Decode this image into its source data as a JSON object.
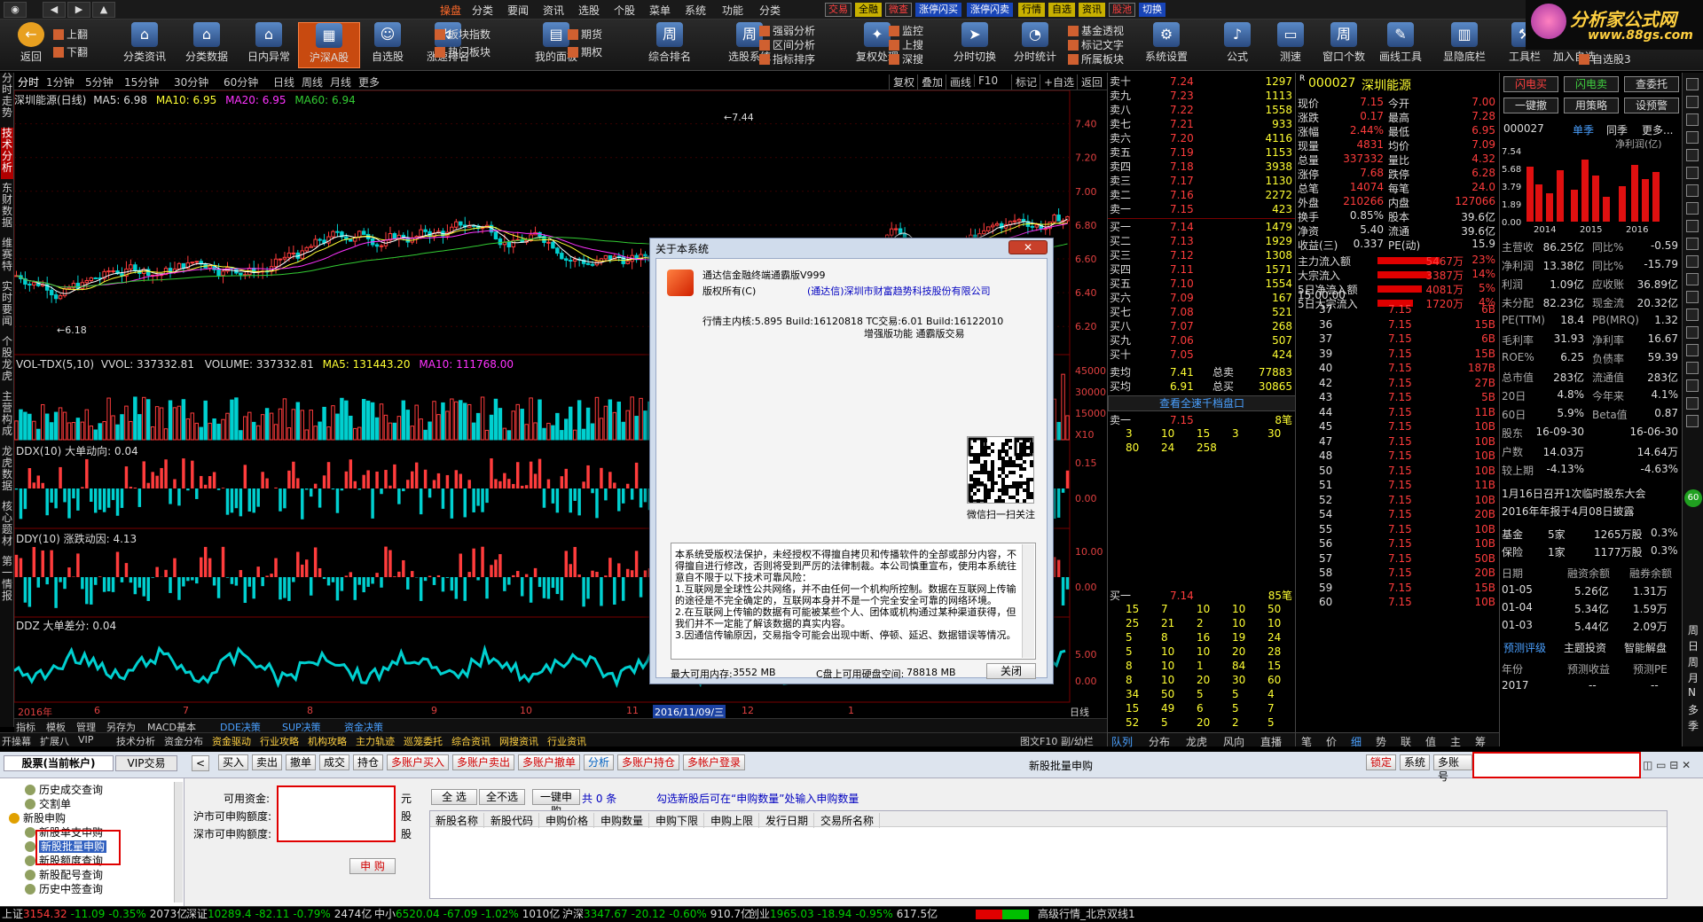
{
  "menu": {
    "items": [
      "操盘",
      "分类",
      "要闻",
      "资讯",
      "选股",
      "个股",
      "菜单",
      "系统",
      "功能",
      "分类"
    ],
    "right_buttons": [
      "交易",
      "全融",
      "微查",
      "涨停闪买",
      "涨停闪卖",
      "行情",
      "自选",
      "资讯",
      "股池",
      "切换"
    ]
  },
  "logo": {
    "text": "分析家公式网",
    "url": "www.88gs.com"
  },
  "toolbar": {
    "big": [
      {
        "label": "返回",
        "icon": "back-icon"
      },
      {
        "label": "分类资讯",
        "icon": "house-icon"
      },
      {
        "label": "分类数据",
        "icon": "house-icon"
      },
      {
        "label": "日内异常",
        "icon": "house-icon"
      },
      {
        "label": "沪深A股",
        "icon": "chart-icon"
      },
      {
        "label": "自选股",
        "icon": "user-icon"
      },
      {
        "label": "涨速排名",
        "icon": "rank-icon"
      },
      {
        "label": "我的面板",
        "icon": "panel-icon"
      },
      {
        "label": "综合排名",
        "icon": "week-icon"
      },
      {
        "label": "选股系统",
        "icon": "week-icon"
      },
      {
        "label": "复权处理",
        "icon": "bulb-icon"
      },
      {
        "label": "分时切换",
        "icon": "arrow-icon"
      },
      {
        "label": "分时统计",
        "icon": "pie-icon"
      },
      {
        "label": "系统设置",
        "icon": "gear-icon"
      },
      {
        "label": "公式",
        "icon": "mic-icon"
      },
      {
        "label": "测速",
        "icon": "printer-icon"
      },
      {
        "label": "窗口个数",
        "icon": "week-icon"
      },
      {
        "label": "画线工具",
        "icon": "draw-icon"
      },
      {
        "label": "显隐底栏",
        "icon": "toggle-icon"
      },
      {
        "label": "工具栏",
        "icon": "tool-icon"
      },
      {
        "label": "加入自选",
        "icon": "add-icon"
      }
    ],
    "small": [
      "上翻",
      "下翻",
      "板块指数",
      "热门板块",
      "期货",
      "期权",
      "强弱分析",
      "区间分析",
      "指标排序",
      "监控",
      "上搜",
      "深搜",
      "基金透视",
      "标记文字",
      "所属板块",
      "自选股3"
    ]
  },
  "chart": {
    "period_tabs": [
      "分时",
      "1分钟",
      "5分钟",
      "15分钟",
      "30分钟",
      "60分钟",
      "日线",
      "周线",
      "月线",
      "更多"
    ],
    "tools": [
      "复权",
      "叠加",
      "画线",
      "F10",
      "标记",
      "+自选",
      "返回"
    ],
    "title": "深圳能源(日线)",
    "ma": [
      "MA5: 6.98",
      "MA10: 6.95",
      "MA20: 6.95",
      "MA60: 6.94"
    ],
    "price_axis": [
      "7.40",
      "7.20",
      "7.00",
      "6.80",
      "6.60",
      "6.40",
      "6.20"
    ],
    "high_mark": "7.44",
    "low_mark": "6.18",
    "vol_title": "VOL-TDX(5,10)",
    "vol_vals": [
      "VVOL: 337332.81",
      "VOLUME: 337332.81",
      "MA5: 131443.20",
      "MA10: 111768.00"
    ],
    "vol_axis": [
      "45000",
      "30000",
      "15000",
      "X10"
    ],
    "ddx_title": "DDX(10) 大单动向: 0.04",
    "ddx_axis": [
      "0.15",
      "0.00"
    ],
    "ddy_title": "DDY(10) 涨跌动因: 4.13",
    "ddy_axis": [
      "10.00",
      "0.00"
    ],
    "ddz_title": "DDZ 大单差分: 0.04",
    "ddz_axis": [
      "5.00",
      "0.00"
    ],
    "dates": [
      "2016年",
      "6",
      "7",
      "8",
      "9",
      "10",
      "11",
      "2016/11/09/三",
      "12",
      "1"
    ],
    "bottom_tabs": [
      "指标",
      "模板",
      "管理",
      "另存为",
      "MACD基本",
      "DDE决策",
      "SUP决策",
      "资金决策"
    ],
    "bottom_tabs2": [
      "开操幕",
      "扩展八",
      "VIP",
      "技术分析",
      "资金分布",
      "资金驱动",
      "行业攻略",
      "机构攻略",
      "主力轨迹",
      "巡笼委托",
      "综合资讯",
      "网搜资讯",
      "行业资讯"
    ],
    "period_right": "日线",
    "figure_f10": "图文F10",
    "switch": "副/幼栏"
  },
  "quote": {
    "sell": [
      {
        "label": "卖十",
        "price": "7.24",
        "vol": "1297"
      },
      {
        "label": "卖九",
        "price": "7.23",
        "vol": "1113"
      },
      {
        "label": "卖八",
        "price": "7.22",
        "vol": "1558"
      },
      {
        "label": "卖七",
        "price": "7.21",
        "vol": "933"
      },
      {
        "label": "卖六",
        "price": "7.20",
        "vol": "4116"
      },
      {
        "label": "卖五",
        "price": "7.19",
        "vol": "1153"
      },
      {
        "label": "卖四",
        "price": "7.18",
        "vol": "3938"
      },
      {
        "label": "卖三",
        "price": "7.17",
        "vol": "1130"
      },
      {
        "label": "卖二",
        "price": "7.16",
        "vol": "2272"
      },
      {
        "label": "卖一",
        "price": "7.15",
        "vol": "423"
      }
    ],
    "buy": [
      {
        "label": "买一",
        "price": "7.14",
        "vol": "1479"
      },
      {
        "label": "买二",
        "price": "7.13",
        "vol": "1929"
      },
      {
        "label": "买三",
        "price": "7.12",
        "vol": "1308"
      },
      {
        "label": "买四",
        "price": "7.11",
        "vol": "1571"
      },
      {
        "label": "买五",
        "price": "7.10",
        "vol": "1554"
      },
      {
        "label": "买六",
        "price": "7.09",
        "vol": "167"
      },
      {
        "label": "买七",
        "price": "7.08",
        "vol": "521"
      },
      {
        "label": "买八",
        "price": "7.07",
        "vol": "268"
      },
      {
        "label": "买九",
        "price": "7.06",
        "vol": "507"
      },
      {
        "label": "买十",
        "price": "7.05",
        "vol": "424"
      }
    ],
    "avg_sell": {
      "label": "卖均",
      "price": "7.41",
      "tl": "总卖",
      "tv": "77883"
    },
    "avg_buy": {
      "label": "买均",
      "price": "6.91",
      "tl": "总买",
      "tv": "30865"
    },
    "full_depth_btn": "查看全速千档盘口",
    "s1": {
      "label": "卖一",
      "price": "7.15",
      "vol": "8笔"
    },
    "s1_rows": [
      [
        "3",
        "10",
        "15",
        "3",
        "30"
      ],
      [
        "80",
        "24",
        "258",
        "",
        ""
      ]
    ],
    "b1": {
      "label": "买一",
      "price": "7.14",
      "vol": "85笔"
    },
    "b1_rows": [
      [
        "15",
        "7",
        "10",
        "10",
        "50"
      ],
      [
        "25",
        "21",
        "2",
        "10",
        "10"
      ],
      [
        "5",
        "8",
        "16",
        "19",
        "24"
      ],
      [
        "5",
        "10",
        "10",
        "20",
        "28"
      ],
      [
        "8",
        "10",
        "1",
        "84",
        "15"
      ],
      [
        "8",
        "10",
        "20",
        "30",
        "60"
      ],
      [
        "34",
        "50",
        "5",
        "5",
        "4"
      ],
      [
        "15",
        "49",
        "6",
        "5",
        "7"
      ],
      [
        "52",
        "5",
        "20",
        "2",
        "5"
      ],
      [
        "10",
        "4",
        "5",
        "4",
        "5"
      ]
    ],
    "tabs": [
      "队列",
      "分布",
      "龙虎",
      "风向",
      "直播"
    ]
  },
  "detail": {
    "code": "000027",
    "name": "深圳能源",
    "rows": [
      [
        "现价",
        "7.15",
        "今开",
        "7.00"
      ],
      [
        "涨跌",
        "0.17",
        "最高",
        "7.28"
      ],
      [
        "涨幅",
        "2.44%",
        "最低",
        "6.95"
      ],
      [
        "现量",
        "4831",
        "均价",
        "7.09"
      ],
      [
        "总量",
        "337332",
        "量比",
        "4.32"
      ],
      [
        "涨停",
        "7.68",
        "跌停",
        "6.28"
      ],
      [
        "总笔",
        "14074",
        "每笔",
        "24.0"
      ],
      [
        "外盘",
        "210266",
        "内盘",
        "127066"
      ],
      [
        "换手",
        "0.85%",
        "股本",
        "39.6亿"
      ],
      [
        "净资",
        "5.40",
        "流通",
        "39.6亿"
      ],
      [
        "收益(三)",
        "0.337",
        "PE(动)",
        "15.9"
      ]
    ],
    "flow": [
      [
        "主力流入额",
        "5467万",
        "23%"
      ],
      [
        "大宗流入",
        "3387万",
        "14%"
      ],
      [
        "5日净流入额",
        "4081万",
        "5%"
      ],
      [
        "5日大宗流入",
        "1720万",
        "4%"
      ]
    ],
    "ticks_time": "15:00:00",
    "ticks": [
      [
        "37",
        "7.15",
        "6B"
      ],
      [
        "36",
        "7.15",
        "15B"
      ],
      [
        "37",
        "7.15",
        "6B"
      ],
      [
        "39",
        "7.15",
        "15B"
      ],
      [
        "40",
        "7.15",
        "187B"
      ],
      [
        "42",
        "7.15",
        "27B"
      ],
      [
        "43",
        "7.15",
        "5B"
      ],
      [
        "44",
        "7.15",
        "11B"
      ],
      [
        "45",
        "7.15",
        "10B"
      ],
      [
        "47",
        "7.15",
        "10B"
      ],
      [
        "48",
        "7.15",
        "10B"
      ],
      [
        "50",
        "7.15",
        "10B"
      ],
      [
        "51",
        "7.15",
        "11B"
      ],
      [
        "52",
        "7.15",
        "10B"
      ],
      [
        "54",
        "7.15",
        "20B"
      ],
      [
        "55",
        "7.15",
        "10B"
      ],
      [
        "56",
        "7.15",
        "10B"
      ],
      [
        "57",
        "7.15",
        "50B"
      ],
      [
        "58",
        "7.15",
        "20B"
      ],
      [
        "59",
        "7.15",
        "15B"
      ],
      [
        "60",
        "7.15",
        "10B"
      ]
    ],
    "bottom_tabs": [
      "笔",
      "价",
      "细",
      "势",
      "联",
      "值",
      "主",
      "筹"
    ]
  },
  "f10": {
    "buttons": [
      "闪电买",
      "闪电卖",
      "查委托",
      "一键撤",
      "用策略",
      "设预警"
    ],
    "code": "000027",
    "season": "单季",
    "compare": "同季",
    "more": "更多...",
    "chart_label": "净利润(亿)",
    "y_axis": [
      "7.54",
      "5.68",
      "3.79",
      "1.89",
      "0.00"
    ],
    "years": [
      "2014",
      "2015",
      "2016"
    ],
    "rows": [
      [
        "主营收",
        "86.25亿",
        "同比%",
        "-0.59"
      ],
      [
        "净利润",
        "13.38亿",
        "同比%",
        "-15.79"
      ],
      [
        "利润",
        "1.09亿",
        "应收账",
        "36.89亿"
      ],
      [
        "未分配",
        "82.23亿",
        "现金流",
        "20.32亿"
      ],
      [
        "PE(TTM)",
        "18.4",
        "PB(MRQ)",
        "1.32"
      ],
      [
        "毛利率",
        "31.93",
        "净利率",
        "16.67"
      ],
      [
        "ROE%",
        "6.25",
        "负债率",
        "59.39"
      ],
      [
        "总市值",
        "283亿",
        "流通值",
        "283亿"
      ],
      [
        "20日",
        "4.8%",
        "今年来",
        "4.1%"
      ],
      [
        "60日",
        "5.9%",
        "Beta值",
        "0.87"
      ],
      [
        "股东",
        "16-09-30",
        "",
        "16-06-30"
      ],
      [
        "户数",
        "14.03万",
        "",
        "14.64万"
      ],
      [
        "较上期",
        "-4.13%",
        "",
        "-4.63%"
      ]
    ],
    "notes": [
      "1月16日召开1次临时股东大会",
      "2016年年报于4月08日披露"
    ],
    "fund": [
      [
        "基金",
        "5家",
        "1265万股",
        "0.3%"
      ],
      [
        "保险",
        "1家",
        "1177万股",
        "0.3%"
      ]
    ],
    "margin_head": [
      "日期",
      "融资余额",
      "融券余额"
    ],
    "margin": [
      [
        "01-05",
        "5.26亿",
        "1.31万"
      ],
      [
        "01-04",
        "5.34亿",
        "1.59万"
      ],
      [
        "01-03",
        "5.44亿",
        "2.09万"
      ]
    ],
    "tabs": [
      "预测评级",
      "主题投资",
      "智能解盘"
    ],
    "forecast_head": [
      "年份",
      "预测收益",
      "预测PE"
    ],
    "forecast": [
      [
        "2017",
        "--",
        "--"
      ]
    ]
  },
  "rightbar": [
    "周",
    "日",
    "周",
    "月",
    "N",
    "多",
    "季"
  ],
  "leftstrip": [
    "分时走势",
    "技术分析",
    "东财数据",
    "维赛特",
    "实时要闻",
    "个股龙虎",
    "主营构成",
    "龙虎数据",
    "核心题材",
    "第一情报"
  ],
  "trade": {
    "account_tab": "股票(当前帐户)",
    "vip_tab": "VIP交易",
    "tree": [
      "历史成交查询",
      "交割单",
      "新股申购",
      "新股单支申购",
      "新股批量申购",
      "新股额度查询",
      "新股配号查询",
      "历史中签查询"
    ],
    "toolbar": [
      "买入",
      "卖出",
      "撤单",
      "成交",
      "持仓",
      "多账户买入",
      "多账户卖出",
      "多账户撤单",
      "分析",
      "多账户持仓",
      "多帐户登录"
    ],
    "title": "新股批量申购",
    "right_buttons": [
      "锁定",
      "系统",
      "多账号"
    ],
    "available_label": "可用资金:",
    "sh_label": "沪市可申购额度:",
    "sz_label": "深市可申购额度:",
    "unit_yuan": "元",
    "unit_gu1": "股",
    "unit_gu2": "股",
    "submit": "申 购",
    "select_all": "全 选",
    "select_none": "全不选",
    "one_click": "一键申购",
    "count_text": "共 0 条",
    "hint": "勾选新股后可在“申购数量”处输入申购数量",
    "columns": [
      "新股名称",
      "新股代码",
      "申购价格",
      "申购数量",
      "申购下限",
      "申购上限",
      "发行日期",
      "交易所名称"
    ]
  },
  "status": {
    "items": [
      {
        "label": "上证",
        "val": "3154.32",
        "chg": "-11.09",
        "pct": "-0.35%",
        "amt": "2073亿"
      },
      {
        "label": "深证",
        "val": "10289.4",
        "chg": "-82.11",
        "pct": "-0.79%",
        "amt": "2474亿"
      },
      {
        "label": "中小",
        "val": "6520.04",
        "chg": "-67.09",
        "pct": "-1.02%",
        "amt": "1010亿"
      },
      {
        "label": "沪深",
        "val": "3347.67",
        "chg": "-20.12",
        "pct": "-0.60%",
        "amt": "910.7亿"
      },
      {
        "label": "创业",
        "val": "1965.03",
        "chg": "-18.94",
        "pct": "-0.95%",
        "amt": "617.5亿"
      }
    ],
    "server": "高级行情_北京双线1"
  },
  "dialog": {
    "title": "关于本系统",
    "product": "通达信金融终端通霸版V999",
    "copyright_label": "版权所有(C)",
    "company": "(通达信)深圳市财富趋势科技股份有限公司",
    "core": "行情主内核:5.895 Build:16120818  TC交易:6.01 Build:16122010",
    "edition": "增强版功能 通霸版交易",
    "qr_caption": "微信扫一扫关注",
    "license": "本系统受版权法保护，未经授权不得擅自拷贝和传播软件的全部或部分内容，不得擅自进行修改，否则将受到严厉的法律制裁。本公司慎重宣布，使用本系统往意自不限于以下技术可靠风险：\n1.互联网是全球性公共网络，并不由任何一个机构所控制。数据在互联网上传输的途径是不完全确定的，互联网本身并不是一个完全安全可靠的网络环境。\n2.在互联网上传输的数据有可能被某些个人、团体或机构通过某种渠道获得，但我们并不一定能了解该数据的真实内容。\n3.因通信传输原因，交易指令可能会出现中断、停顿、延迟、数据错误等情况。",
    "mem_label": "最大可用内存:",
    "mem_val": "3552 MB",
    "disk_label": "C盘上可用硬盘空间:",
    "disk_val": "78818 MB",
    "close": "关闭"
  },
  "colors": {
    "up": "#ff3c3c",
    "down": "#00d0d0",
    "ma5": "#ffffff",
    "ma10": "#ffff33",
    "ma20": "#ff33ff",
    "ma60": "#33cc33"
  }
}
